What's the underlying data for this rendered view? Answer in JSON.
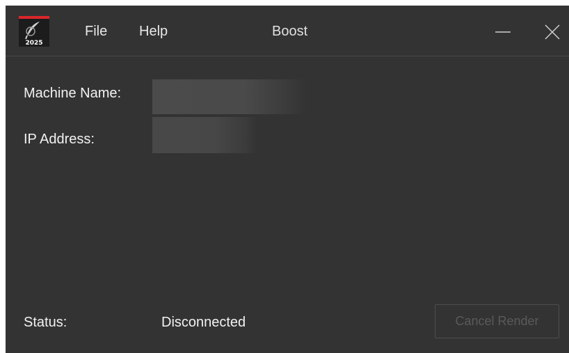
{
  "app": {
    "logo_year": "2025",
    "title": "Boost"
  },
  "menu": {
    "file": "File",
    "help": "Help"
  },
  "fields": {
    "machine_name_label": "Machine Name:",
    "ip_address_label": "IP Address:"
  },
  "status": {
    "label": "Status:",
    "value": "Disconnected"
  },
  "actions": {
    "cancel_render": "Cancel Render",
    "cancel_render_enabled": false
  },
  "colors": {
    "window_bg": "#333333",
    "logo_accent": "#d9262b",
    "text": "#f2f2f2",
    "disabled_text": "#5a5a5a"
  },
  "icons": {
    "minimize": "minimize-icon",
    "close": "close-icon",
    "logo": "app-logo-icon"
  }
}
